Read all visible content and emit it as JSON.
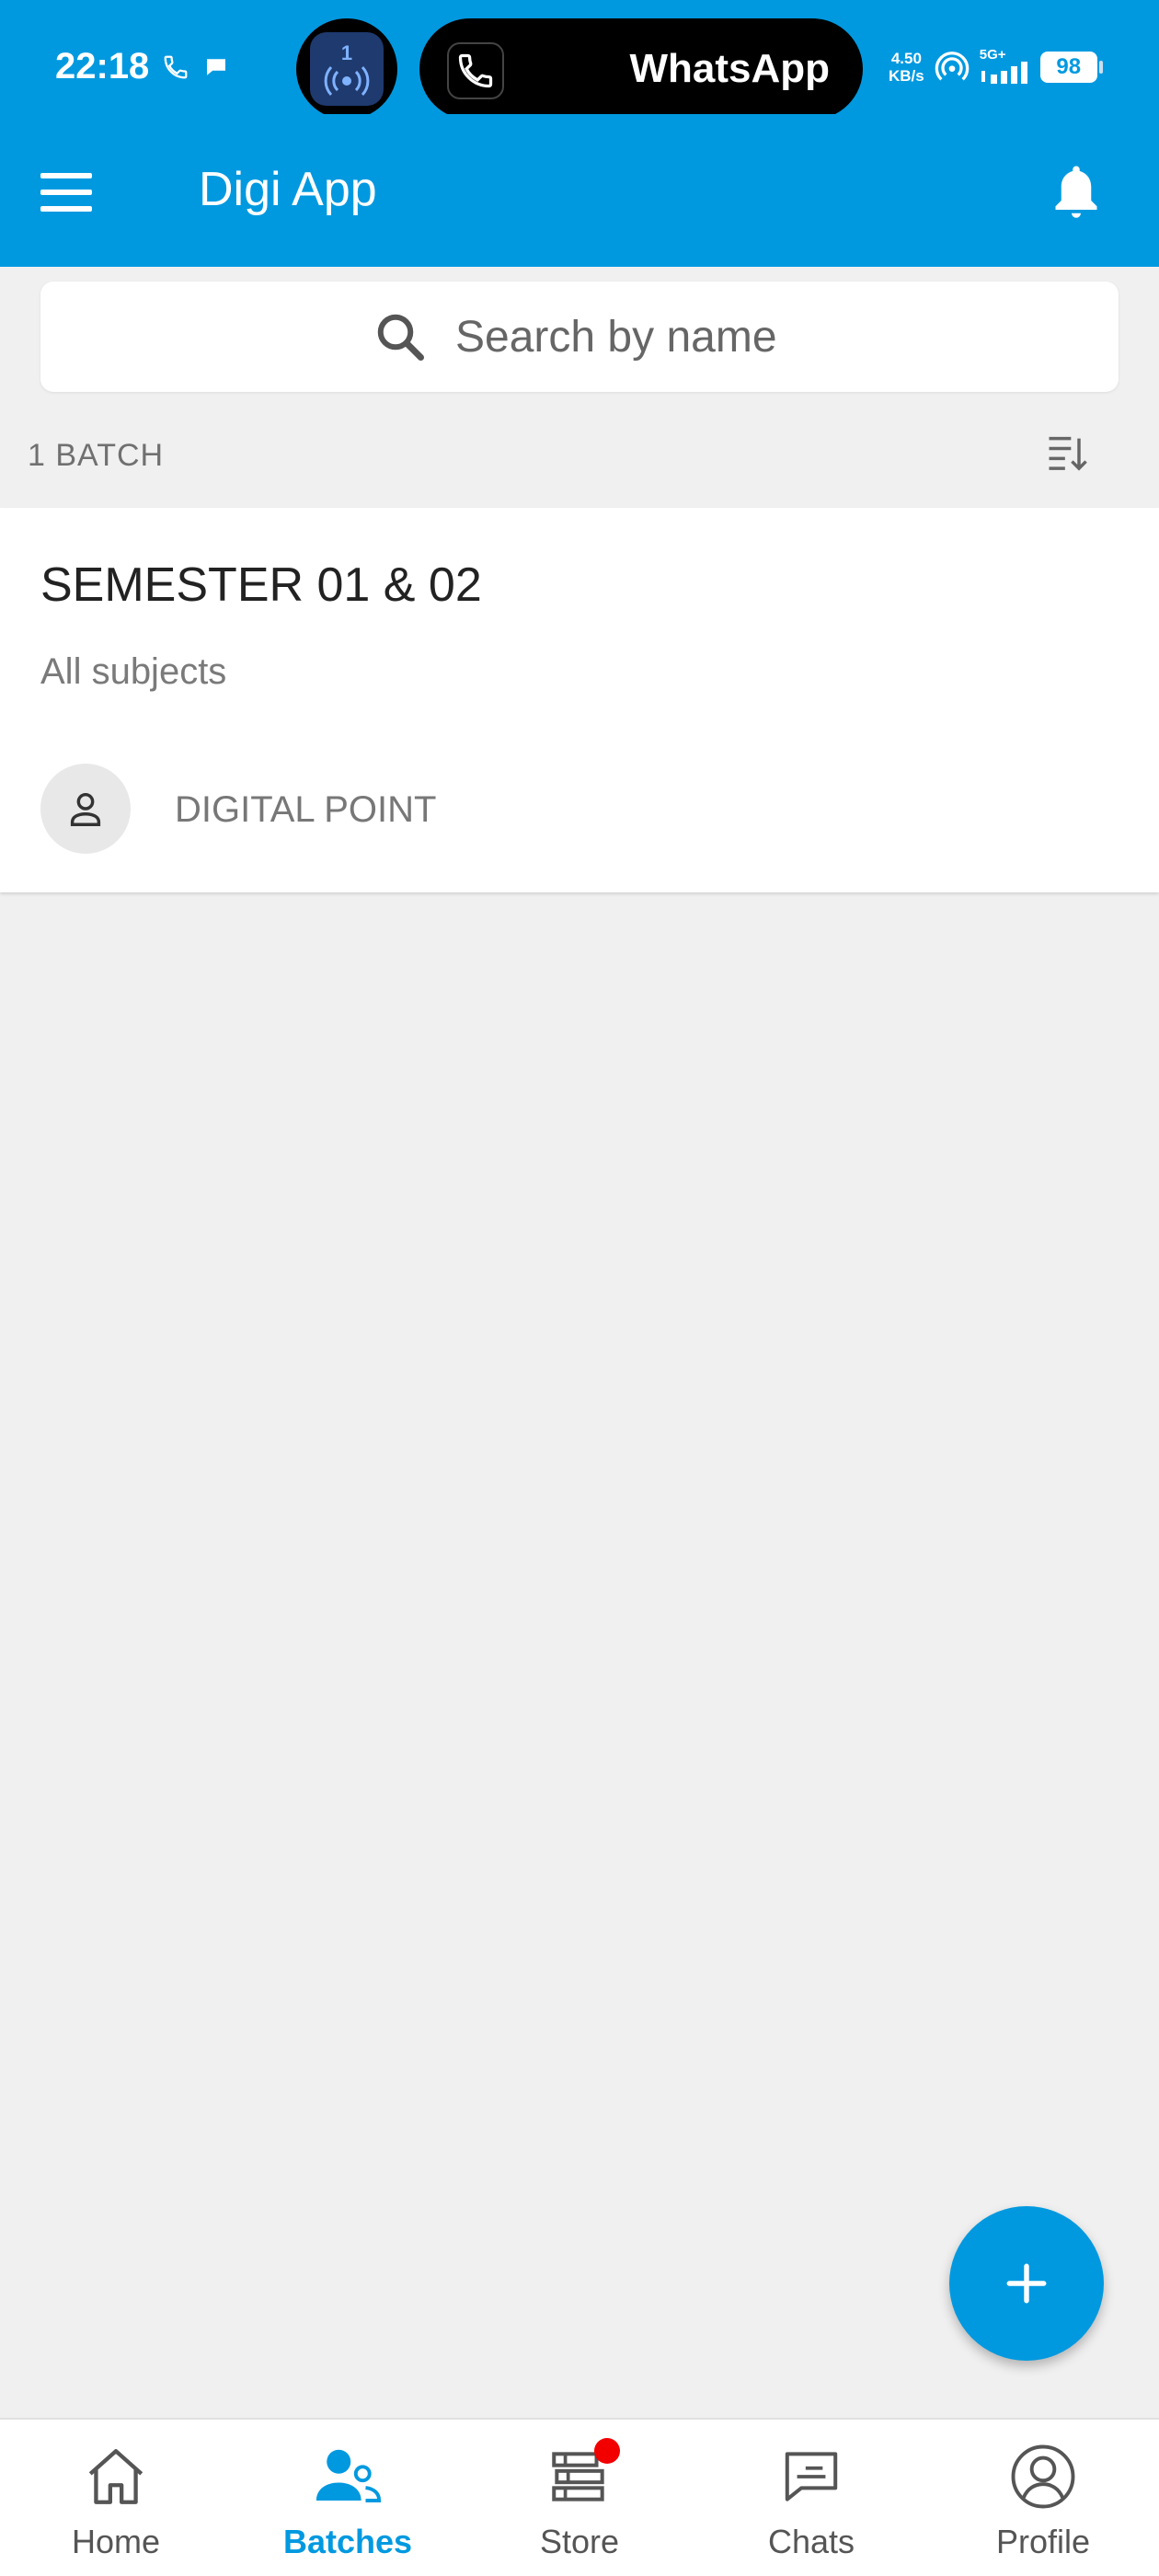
{
  "status_bar": {
    "time": "22:18",
    "hotspot_count": "1",
    "call_app_name": "WhatsApp",
    "net_speed_value": "4.50",
    "net_speed_unit": "KB/s",
    "network_type": "5G+",
    "battery": "98"
  },
  "app_bar": {
    "title": "Digi App"
  },
  "search": {
    "placeholder": "Search by name"
  },
  "batches": {
    "count_label": "1 BATCH",
    "items": [
      {
        "title": "SEMESTER 01 & 02",
        "subtitle": "All subjects",
        "teacher": "DIGITAL POINT"
      }
    ]
  },
  "bottom_nav": {
    "items": [
      {
        "label": "Home",
        "icon": "home-icon",
        "active": false
      },
      {
        "label": "Batches",
        "icon": "batches-icon",
        "active": true
      },
      {
        "label": "Store",
        "icon": "store-icon",
        "active": false,
        "badge": true
      },
      {
        "label": "Chats",
        "icon": "chat-icon",
        "active": false
      },
      {
        "label": "Profile",
        "icon": "profile-icon",
        "active": false
      }
    ]
  },
  "colors": {
    "primary": "#0099e0",
    "background": "#f0f0f0",
    "badge": "#f20000"
  }
}
